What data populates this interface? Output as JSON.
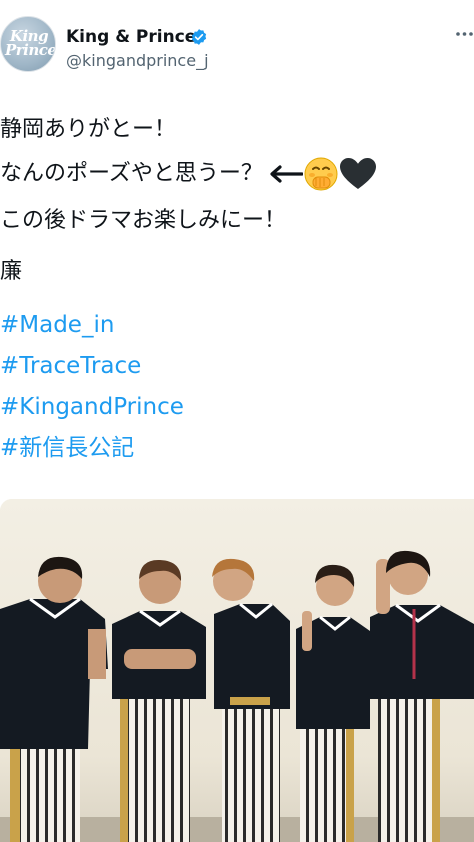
{
  "account": {
    "display_name": "King & Prince",
    "handle": "@kingandprince_j",
    "avatar_text": [
      "King",
      "Prince"
    ],
    "verified": true
  },
  "tweet": {
    "line1": "静岡ありがとー！",
    "line2": "なんのポーズやと思うー？",
    "line2_emoji": [
      "arrow-left-icon",
      "hand-over-mouth-emoji",
      "black-heart-emoji"
    ],
    "line3": "この後ドラマお楽しみにー！",
    "signature": "廉",
    "hashtags": [
      "#Made_in",
      "#TraceTrace",
      "#KingandPrince",
      "#新信長公記"
    ]
  },
  "colors": {
    "hashtag": "#1d9bf0",
    "verified": "#1d9bf0",
    "text": "#0f1419",
    "secondary": "#536471"
  },
  "media": {
    "type": "photo",
    "people_count": 5
  }
}
